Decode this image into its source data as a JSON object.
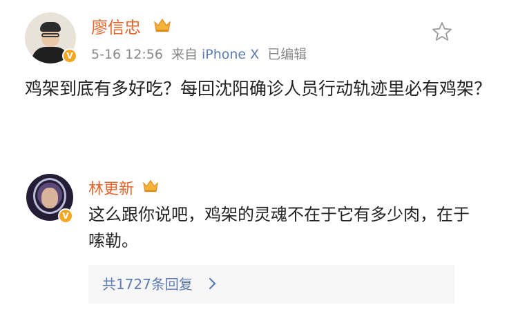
{
  "post": {
    "author": "廖信忠",
    "timestamp": "5-16 12:56",
    "source_prefix": "来自",
    "device": "iPhone X",
    "edited_label": "已编辑",
    "text": "鸡架到底有多好吃？每回沈阳确诊人员行动轨迹里必有鸡架？",
    "icons": {
      "verified": "verified-v-icon",
      "crown": "crown-icon",
      "favorite": "star-icon"
    },
    "colors": {
      "name": "#e8652b",
      "link": "#5b7bb0",
      "meta": "#888888",
      "badge": "#f5a623"
    }
  },
  "comment": {
    "author": "林更新",
    "text": "这么跟你说吧，鸡架的灵魂不在于它有多少肉，在于嗦勒。",
    "replies_label": "共1727条回复",
    "icons": {
      "verified": "verified-v-icon",
      "crown": "crown-icon",
      "chevron": "chevron-right-icon"
    }
  }
}
